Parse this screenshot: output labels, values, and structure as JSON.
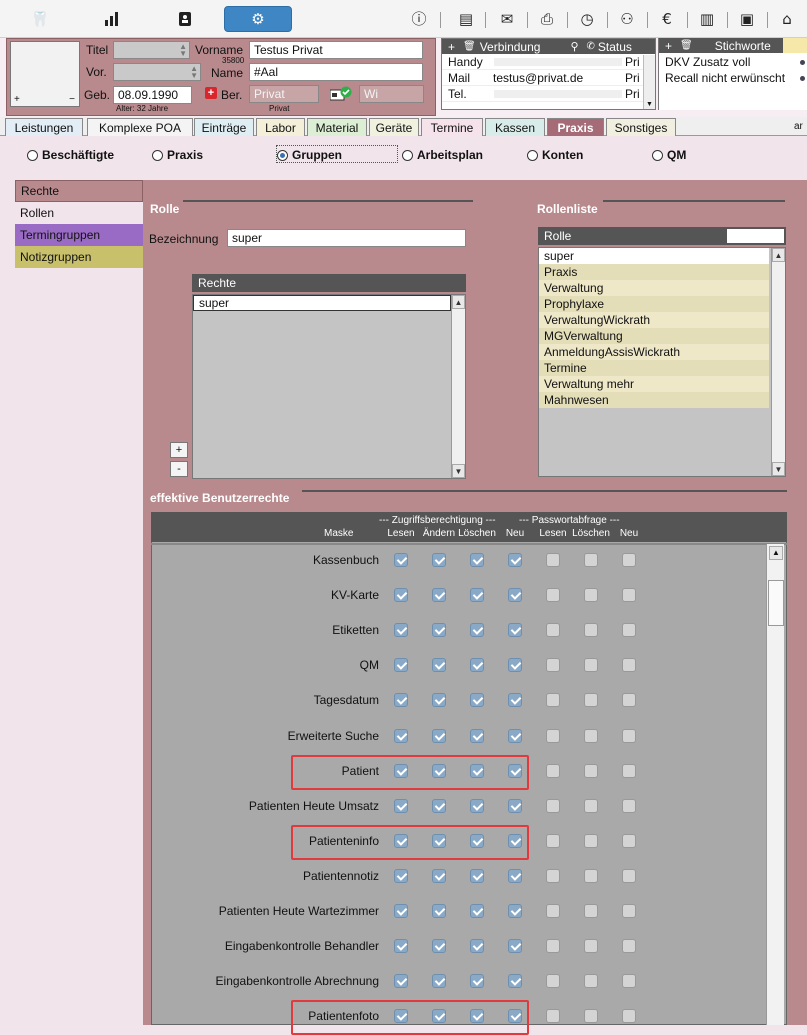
{
  "toolbar": {
    "left_icons": [
      "tooth-icon",
      "chart-icon",
      "contacts-icon",
      "gear-icon"
    ],
    "right_icons": [
      "info-icon",
      "notes-icon",
      "mail-icon",
      "print-icon",
      "history-icon",
      "family-icon",
      "billing-icon",
      "book-icon",
      "screen-icon",
      "tag-icon"
    ]
  },
  "patient": {
    "titel_label": "Titel",
    "vor_label": "Vor.",
    "geb_label": "Geb.",
    "geb_value": "08.09.1990",
    "alter": "Alter: 32 Jahre",
    "vorname_label": "Vorname",
    "vorname_value": "Testus  Privat",
    "pat_nr": "35800",
    "name_label": "Name",
    "name_value": "#Aal",
    "ber_label": "Ber.",
    "ber_value": "Privat",
    "ber_sub": "Privat",
    "wi_value": "Wi",
    "photo_plus": "+",
    "photo_minus": "−"
  },
  "contact": {
    "add": "+",
    "delete": "🗑",
    "verbindung": "Verbindung",
    "status": "Status",
    "rows": [
      {
        "type": "Handy",
        "value": "",
        "status": "Pri"
      },
      {
        "type": "Mail",
        "value": "testus@privat.de",
        "status": "Pri"
      },
      {
        "type": "Tel.",
        "value": "",
        "status": "Pri"
      }
    ]
  },
  "keywords": {
    "add": "+",
    "delete": "🗑",
    "title": "Stichworte",
    "items": [
      "DKV Zusatz voll",
      "Recall nicht erwünscht"
    ]
  },
  "tabs": [
    "Leistungen",
    "Komplexe POA",
    "Einträge",
    "Labor",
    "Material",
    "Geräte",
    "Termine",
    "Kassen",
    "Praxis",
    "Sonstiges"
  ],
  "tab_colors": [
    "#e3edf5",
    "#f4f4f4",
    "#dfeef3",
    "#f4efd8",
    "#dcefd4",
    "#f1f1df",
    "#f5e2ea",
    "#d8ece9",
    "#a56c78",
    "#f1efe0"
  ],
  "active_tab": "Praxis",
  "tab_overflow": "ar",
  "radios": [
    {
      "label": "Beschäftigte",
      "checked": false
    },
    {
      "label": "Praxis",
      "checked": false
    },
    {
      "label": "Gruppen",
      "checked": true
    },
    {
      "label": "Arbeitsplan",
      "checked": false
    },
    {
      "label": "Konten",
      "checked": false
    },
    {
      "label": "QM",
      "checked": false
    }
  ],
  "left_menu": [
    {
      "label": "Rechte",
      "color": "#b88a8d"
    },
    {
      "label": "Rollen",
      "color": "#f1e4ea"
    },
    {
      "label": "Termingruppen",
      "color": "#9a6bc4"
    },
    {
      "label": "Notizgruppen",
      "color": "#c8c06a"
    }
  ],
  "rolle": {
    "title": "Rolle",
    "bezeichnung_label": "Bezeichnung",
    "bezeichnung_value": "super",
    "rechte_header": "Rechte",
    "rechte_items": [
      "super"
    ],
    "plus": "+",
    "minus": "-"
  },
  "rollenliste": {
    "title": "Rollenliste",
    "header": "Rolle",
    "items": [
      "super",
      "Praxis",
      "Verwaltung",
      "Prophylaxe",
      "VerwaltungWickrath",
      "MGVerwaltung",
      "AnmeldungAssisWickrath",
      "Termine",
      "Verwaltung mehr",
      "Mahnwesen"
    ]
  },
  "eff": {
    "title": "effektive Benutzerrechte",
    "group1": "--- Zugriffsberechtigung ---",
    "group2": "--- Passwortabfrage ---",
    "col_maske": "Maske",
    "cols": [
      "Lesen",
      "Ändern",
      "Löschen",
      "Neu",
      "Lesen",
      "Löschen",
      "Neu"
    ],
    "rows": [
      {
        "name": "Kassenbuch",
        "checks": [
          true,
          true,
          true,
          true,
          false,
          false,
          false
        ],
        "highlight": false
      },
      {
        "name": "KV-Karte",
        "checks": [
          true,
          true,
          true,
          true,
          false,
          false,
          false
        ],
        "highlight": false
      },
      {
        "name": "Etiketten",
        "checks": [
          true,
          true,
          true,
          true,
          false,
          false,
          false
        ],
        "highlight": false
      },
      {
        "name": "QM",
        "checks": [
          true,
          true,
          true,
          true,
          false,
          false,
          false
        ],
        "highlight": false
      },
      {
        "name": "Tagesdatum",
        "checks": [
          true,
          true,
          true,
          true,
          false,
          false,
          false
        ],
        "highlight": false
      },
      {
        "name": "Erweiterte Suche",
        "checks": [
          true,
          true,
          true,
          true,
          false,
          false,
          false
        ],
        "highlight": false
      },
      {
        "name": "Patient",
        "checks": [
          true,
          true,
          true,
          true,
          false,
          false,
          false
        ],
        "highlight": true
      },
      {
        "name": "Patienten Heute Umsatz",
        "checks": [
          true,
          true,
          true,
          true,
          false,
          false,
          false
        ],
        "highlight": false
      },
      {
        "name": "Patienteninfo",
        "checks": [
          true,
          true,
          true,
          true,
          false,
          false,
          false
        ],
        "highlight": true
      },
      {
        "name": "Patientennotiz",
        "checks": [
          true,
          true,
          true,
          true,
          false,
          false,
          false
        ],
        "highlight": false
      },
      {
        "name": "Patienten Heute Wartezimmer",
        "checks": [
          true,
          true,
          true,
          true,
          false,
          false,
          false
        ],
        "highlight": false
      },
      {
        "name": "Eingabenkontrolle Behandler",
        "checks": [
          true,
          true,
          true,
          true,
          false,
          false,
          false
        ],
        "highlight": false
      },
      {
        "name": "Eingabenkontrolle Abrechnung",
        "checks": [
          true,
          true,
          true,
          true,
          false,
          false,
          false
        ],
        "highlight": false
      },
      {
        "name": "Patientenfoto",
        "checks": [
          true,
          true,
          true,
          true,
          false,
          false,
          false
        ],
        "highlight": true
      }
    ]
  }
}
